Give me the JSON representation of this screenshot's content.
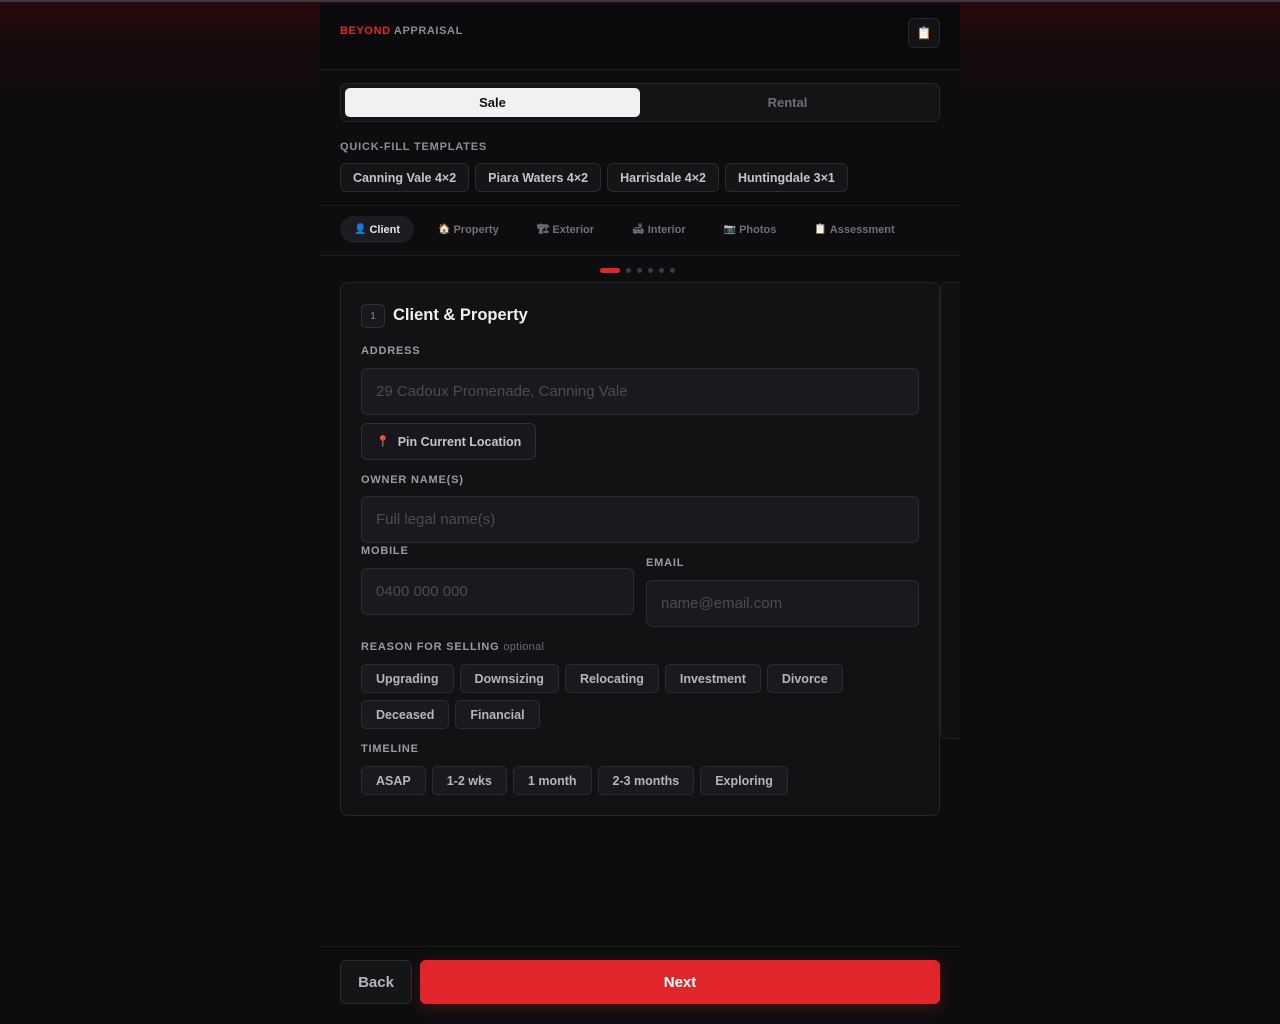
{
  "header": {
    "brand_part1": "BEYOND",
    "brand_part2": "APPRAISAL",
    "icon": "clipboard-icon"
  },
  "mode_toggle": {
    "options": [
      "Sale",
      "Rental"
    ],
    "selected": "Sale"
  },
  "quick_fill": {
    "label": "QUICK-FILL TEMPLATES",
    "templates": [
      "Canning Vale 4×2",
      "Piara Waters 4×2",
      "Harrisdale 4×2",
      "Huntingdale 3×1"
    ]
  },
  "tabs": [
    {
      "icon": "👤",
      "label": "Client",
      "active": true
    },
    {
      "icon": "🏠",
      "label": "Property",
      "active": false
    },
    {
      "icon": "🏗",
      "label": "Exterior",
      "active": false
    },
    {
      "icon": "🛋",
      "label": "Interior",
      "active": false
    },
    {
      "icon": "📷",
      "label": "Photos",
      "active": false
    },
    {
      "icon": "📋",
      "label": "Assessment",
      "active": false
    }
  ],
  "progress": {
    "current_step": 1,
    "total_steps": 6
  },
  "card": {
    "step_number": "1",
    "title": "Client & Property",
    "address": {
      "label": "ADDRESS",
      "placeholder": "29 Cadoux Promenade, Canning Vale",
      "value": ""
    },
    "pin_button": {
      "icon": "📍",
      "label": "Pin Current Location"
    },
    "owner": {
      "label": "OWNER NAME(S)",
      "placeholder": "Full legal name(s)",
      "value": ""
    },
    "mobile": {
      "label": "MOBILE",
      "placeholder": "0400 000 000",
      "value": ""
    },
    "email": {
      "label": "EMAIL",
      "placeholder": "name@email.com",
      "value": ""
    },
    "reason": {
      "label": "REASON FOR SELLING",
      "optional": "optional",
      "options": [
        "Upgrading",
        "Downsizing",
        "Relocating",
        "Investment",
        "Divorce",
        "Deceased",
        "Financial"
      ]
    },
    "timeline": {
      "label": "TIMELINE",
      "options": [
        "ASAP",
        "1-2 wks",
        "1 month",
        "2-3 months",
        "Exploring"
      ]
    }
  },
  "footer": {
    "back_label": "Back",
    "next_label": "Next"
  },
  "colors": {
    "accent": "#e2272b",
    "background": "#0c0c0e",
    "card": "#121215"
  }
}
